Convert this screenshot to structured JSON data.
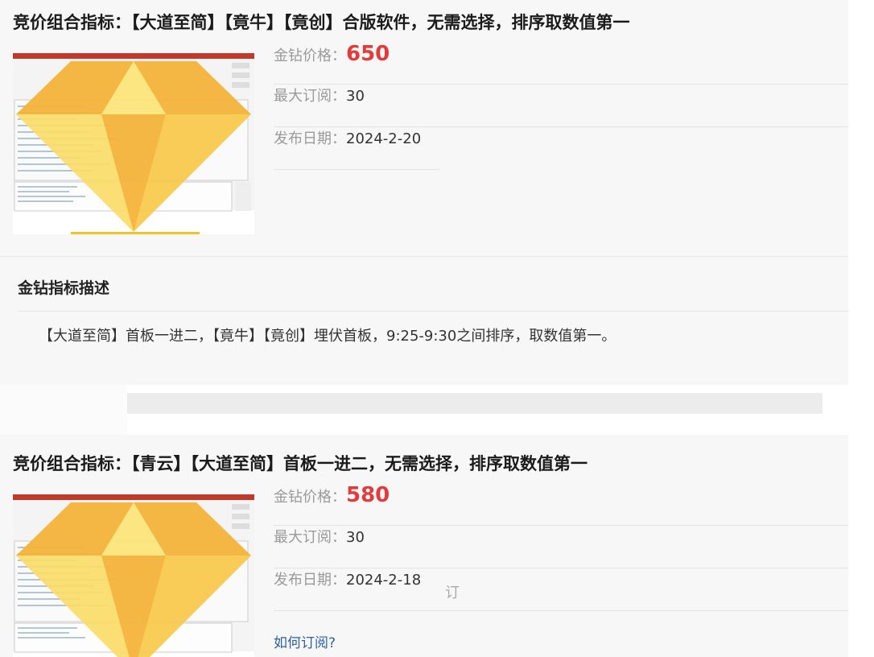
{
  "products": [
    {
      "title": "竞价组合指标：【大道至简】【竟牛】【竟创】合版软件，无需选择，排序取数值第一",
      "price_label": "金钻价格：",
      "price_value": "650",
      "subs_label": "最大订阅：",
      "subs_value": "30",
      "date_label": "发布日期：",
      "date_value": "2024-2-20",
      "description_heading": "金钻指标描述",
      "description_text": "【大道至简】首板一进二，【竟牛】【竟创】埋伏首板，9:25-9:30之间排序，取数值第一。"
    },
    {
      "title": "竞价组合指标：【青云】【大道至简】首板一进二，无需选择，排序取数值第一",
      "price_label": "金钻价格：",
      "price_value": "580",
      "subs_label": "最大订阅：",
      "subs_value": "30",
      "date_label": "发布日期：",
      "date_value": "2024-2-18",
      "link_text": "如何订阅?",
      "stray_glyph": "订"
    }
  ],
  "colors": {
    "price": "#e23b3b",
    "link": "#2f5fa8",
    "diamond_light": "#f9d64a",
    "diamond_dark": "#f3a733",
    "window_bar": "#c0392b"
  },
  "icons": {
    "thumbnail": "diamond-over-screenshot"
  }
}
